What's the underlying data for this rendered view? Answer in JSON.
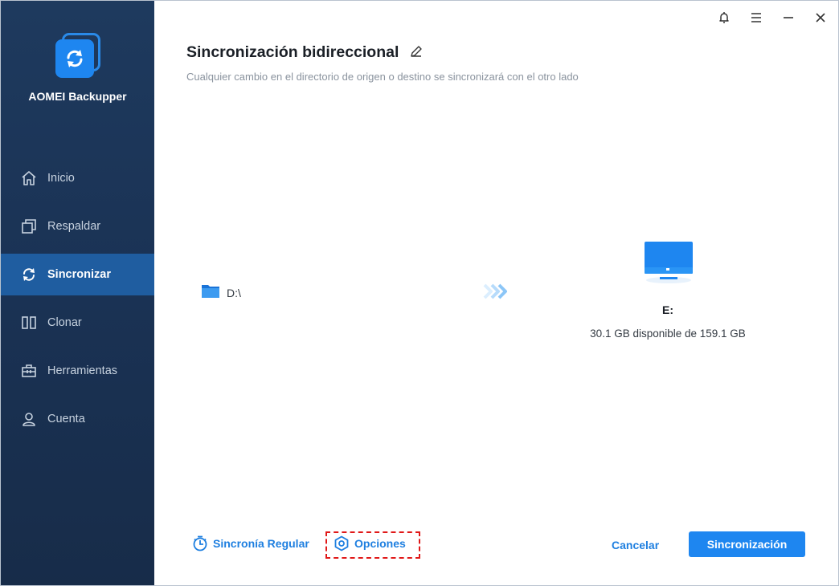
{
  "app": {
    "name": "AOMEI Backupper"
  },
  "sidebar": {
    "items": [
      {
        "label": "Inicio",
        "icon": "home-icon",
        "active": false
      },
      {
        "label": "Respaldar",
        "icon": "backup-icon",
        "active": false
      },
      {
        "label": "Sincronizar",
        "icon": "sync-icon",
        "active": true
      },
      {
        "label": "Clonar",
        "icon": "clone-icon",
        "active": false
      },
      {
        "label": "Herramientas",
        "icon": "toolbox-icon",
        "active": false
      },
      {
        "label": "Cuenta",
        "icon": "user-icon",
        "active": false
      }
    ]
  },
  "titlebar": {
    "icons": [
      "bell-icon",
      "menu-icon",
      "minimize-icon",
      "close-icon"
    ]
  },
  "main": {
    "title": "Sincronización bidireccional",
    "subtitle": "Cualquier cambio en el directorio de origen o destino se sincronizará con el otro lado",
    "source": {
      "label": "D:\\"
    },
    "destination": {
      "name": "E:",
      "info": "30.1 GB disponible de 159.1 GB"
    }
  },
  "footer": {
    "schedule_label": "Sincronía Regular",
    "options_label": "Opciones",
    "cancel_label": "Cancelar",
    "sync_label": "Sincronización"
  },
  "colors": {
    "accent": "#1e86f0",
    "sidebar_bg": "#1a3254",
    "sidebar_active": "#1f5da0",
    "highlight_box": "#e01818"
  }
}
